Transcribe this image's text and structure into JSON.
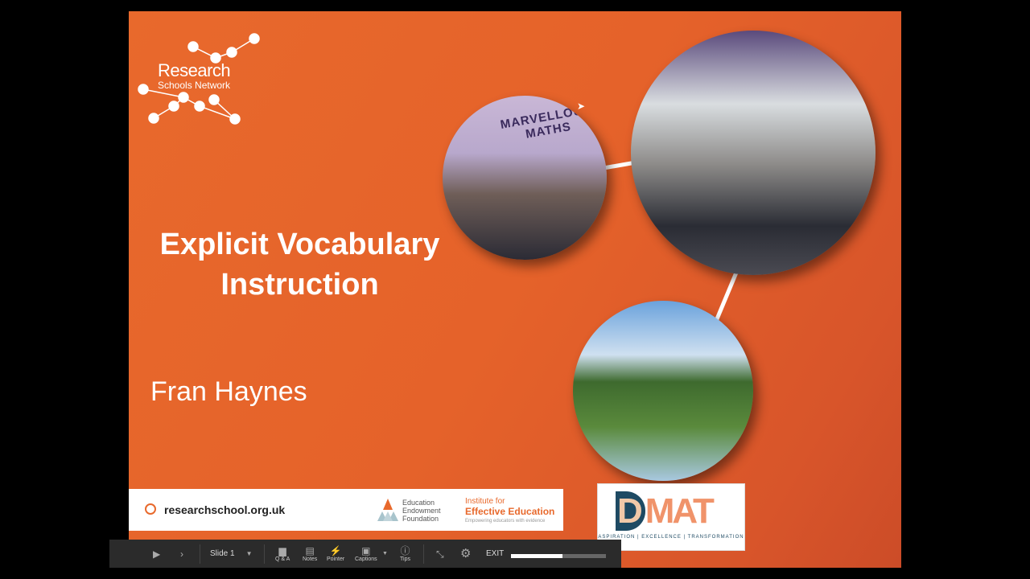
{
  "slide": {
    "logo": {
      "line1": "Research",
      "line2": "Schools Network"
    },
    "title_line1": "Explicit Vocabulary",
    "title_line2": "Instruction",
    "author": "Fran Haynes",
    "photo_sign": "MARVELLOUS MATHS",
    "footer": {
      "url": "researchschool.org.uk",
      "eef_lines": [
        "Education",
        "Endowment",
        "Foundation"
      ],
      "iee_line1": "Institute for",
      "iee_line2": "Effective Education",
      "iee_tagline": "Empowering educators with evidence"
    },
    "dmat": {
      "name": "DMAT",
      "tagline": "ASPIRATION | EXCELLENCE | TRANSFORMATION"
    }
  },
  "toolbar": {
    "slide_select": "Slide 1",
    "qa": "Q & A",
    "notes": "Notes",
    "pointer": "Pointer",
    "captions": "Captions",
    "tips": "Tips",
    "exit": "EXIT",
    "progress": 0.54
  },
  "colors": {
    "accent": "#e8692c",
    "navy": "#1e4a63"
  }
}
